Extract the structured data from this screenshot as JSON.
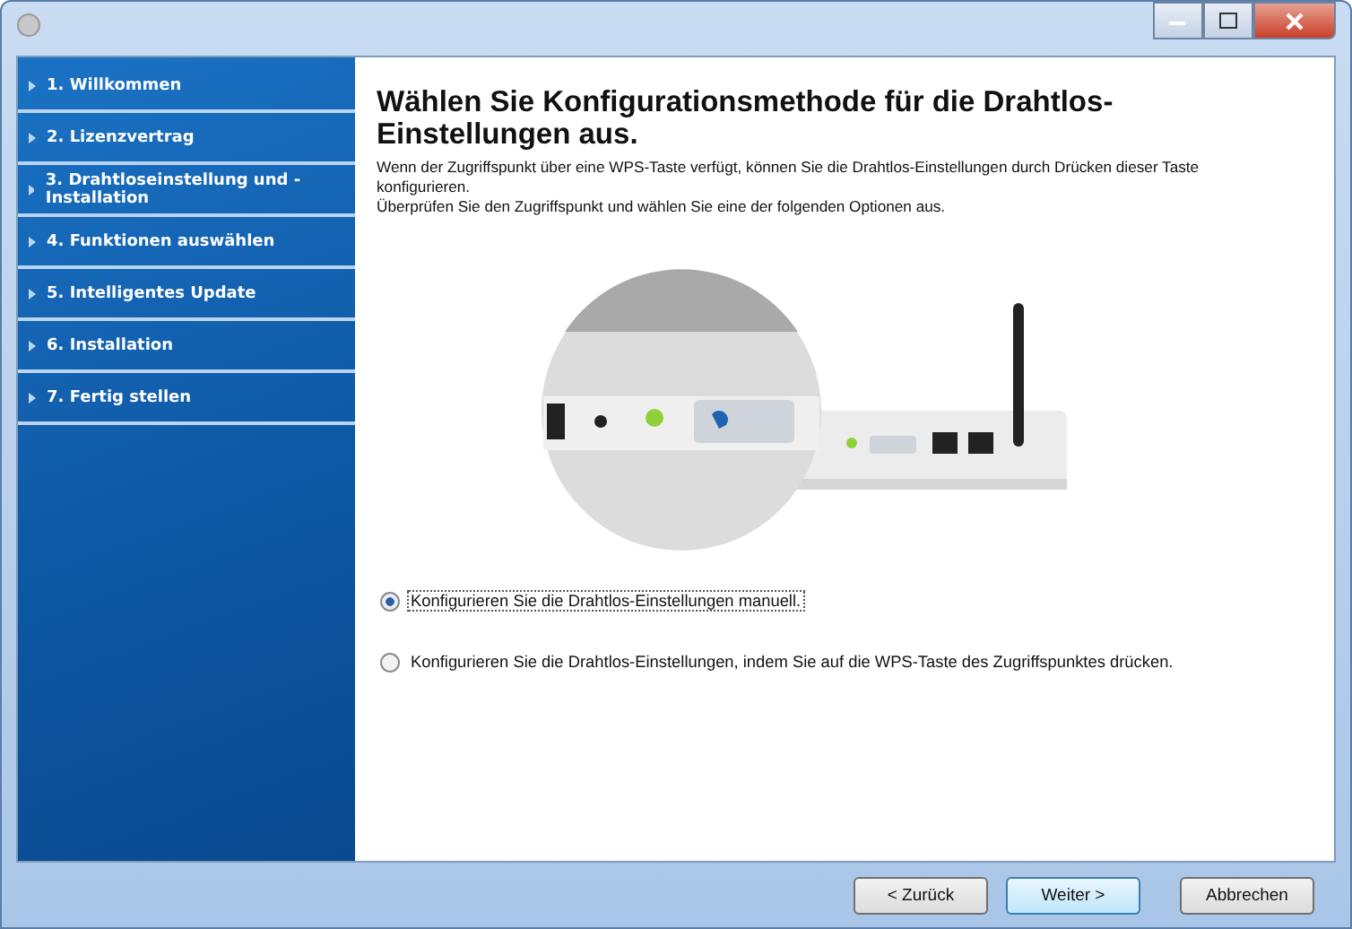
{
  "steps": [
    {
      "label": "1. Willkommen"
    },
    {
      "label": "2. Lizenzvertrag"
    },
    {
      "label": "3. Drahtloseinstellung und -Installation"
    },
    {
      "label": "4. Funktionen auswählen"
    },
    {
      "label": "5. Intelligentes Update"
    },
    {
      "label": "6. Installation"
    },
    {
      "label": "7. Fertig stellen"
    }
  ],
  "heading": "Wählen Sie Konfigurationsmethode für die Drahtlos-Einstellungen aus.",
  "description": [
    "Wenn der Zugriffspunkt über eine WPS-Taste verfügt, können Sie die Drahtlos-Einstellungen durch Drücken dieser Taste konfigurieren.",
    "Überprüfen Sie den Zugriffspunkt und wählen Sie eine der folgenden Optionen aus."
  ],
  "illustration": {
    "kind": "picture"
  },
  "options": [
    {
      "label": "Konfigurieren Sie die Drahtlos-Einstellungen manuell.",
      "selected": true
    },
    {
      "label": "Konfigurieren Sie die Drahtlos-Einstellungen, indem Sie auf die WPS-Taste des Zugriffspunktes drücken.",
      "selected": false
    }
  ],
  "buttons": [
    {
      "label": "< Zurück",
      "default": false
    },
    {
      "label": "Weiter >",
      "default": true
    },
    {
      "label": "Abbrechen",
      "default": false
    }
  ]
}
